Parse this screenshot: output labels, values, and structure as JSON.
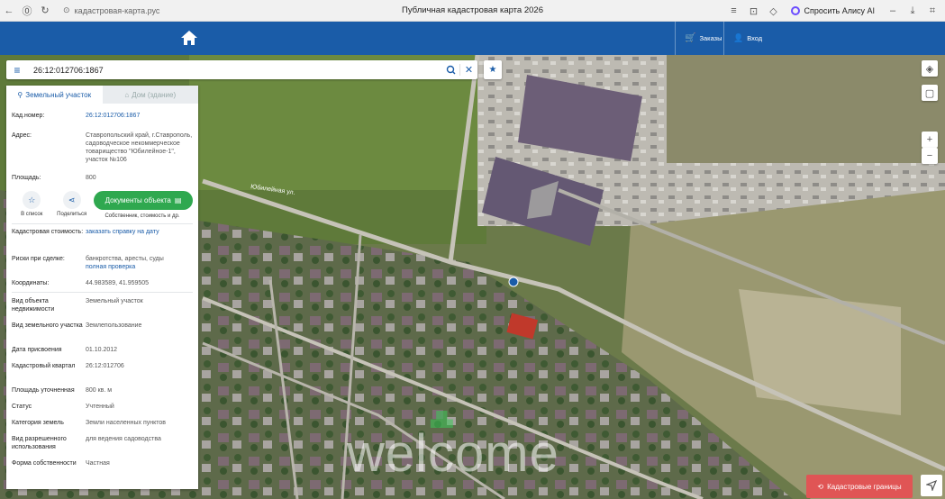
{
  "browser": {
    "url": "кадастровая-карта.рус",
    "title": "Публичная кадастровая карта 2026",
    "alisa_label": "Спросить Алису AI"
  },
  "header": {
    "orders_label": "Заказы",
    "login_label": "Вход"
  },
  "search": {
    "value": "26:12:012706:1867"
  },
  "panel": {
    "tabs": [
      {
        "label": "Земельный участок"
      },
      {
        "label": "Дом (здание)"
      }
    ],
    "top_rows": [
      {
        "key": "Кад.номер:",
        "value": "26:12:012706:1867"
      },
      {
        "key": "Адрес:",
        "value": "Ставропольский край, г.Ставрополь, садоводческое некоммерческое товарищество \"Юбилейное-1\", участок №106"
      },
      {
        "key": "Площадь:",
        "value": "800"
      }
    ],
    "actions": {
      "list_label": "В список",
      "share_label": "Поделиться",
      "docs_label": "Документы объекта",
      "docs_sub": "Собственник, стоимость и др."
    },
    "details": [
      {
        "key": "Кадастровая стоимость:",
        "value": "заказать справку на дату"
      },
      {
        "key": "Риски при сделке:",
        "value": "банкротства, аресты, суды",
        "extra": "полная проверка"
      },
      {
        "key": "Координаты:",
        "value": "44.983589, 41.959505"
      },
      {
        "key": "Вид объекта недвижимости",
        "value": "Земельный участок"
      },
      {
        "key": "Вид земельного участка",
        "value": "Землепользование"
      },
      {
        "key": "Дата присвоения",
        "value": "01.10.2012"
      },
      {
        "key": "Кадастровый квартал",
        "value": "26:12:012706"
      },
      {
        "key": "Площадь уточненная",
        "value": "800 кв. м"
      },
      {
        "key": "Статус",
        "value": "Учтенный"
      },
      {
        "key": "Категория земель",
        "value": "Земли населенных пунктов"
      },
      {
        "key": "Вид разрешенного использования",
        "value": "для ведения садоводства"
      },
      {
        "key": "Форма собственности",
        "value": "Частная"
      }
    ]
  },
  "map": {
    "street_label": "Юбилейная ул.",
    "cadastral_button": "Кадастровые границы",
    "watermark": "welcome"
  }
}
